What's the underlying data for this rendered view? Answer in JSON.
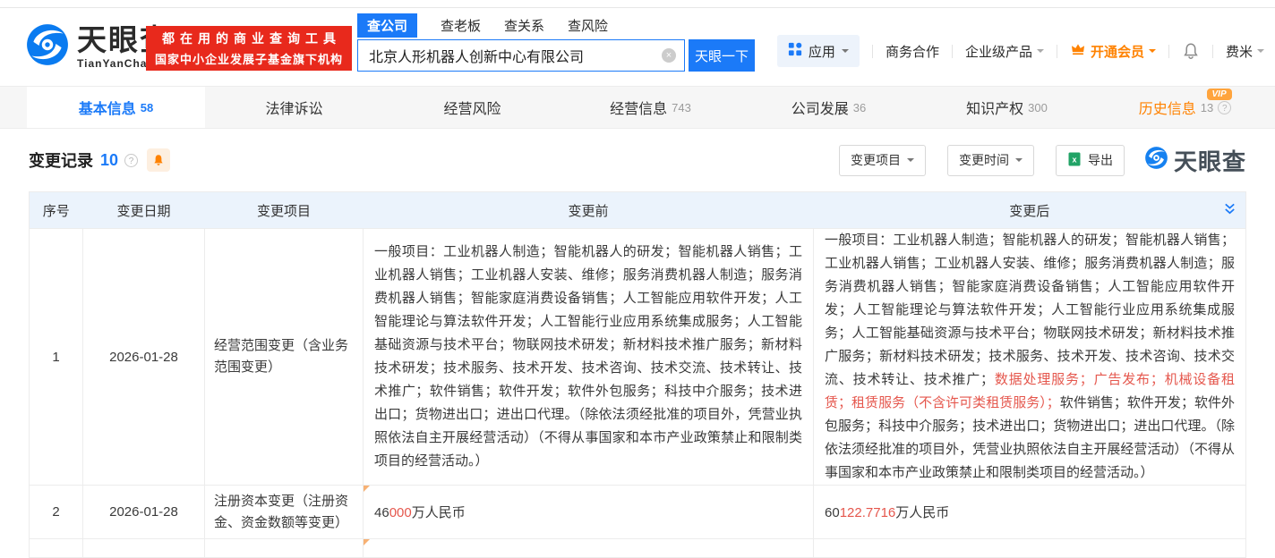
{
  "header": {
    "logo": {
      "name": "天眼查",
      "domain": "TianYanCha.com"
    },
    "promo": {
      "line1": "都在用的商业查询工具",
      "line2": "国家中小企业发展子基金旗下机构"
    },
    "search": {
      "tabs": [
        {
          "label": "查公司"
        },
        {
          "label": "查老板"
        },
        {
          "label": "查关系"
        },
        {
          "label": "查风险"
        }
      ],
      "value": "北京人形机器人创新中心有限公司",
      "button_label": "天眼一下"
    },
    "nav": {
      "apps": "应用",
      "cooperation": "商务合作",
      "enterprise": "企业级产品",
      "vip": "开通会员",
      "user": "费米"
    }
  },
  "tabs": [
    {
      "label": "基本信息",
      "count": "58"
    },
    {
      "label": "法律诉讼",
      "count": ""
    },
    {
      "label": "经营风险",
      "count": ""
    },
    {
      "label": "经营信息",
      "count": "743"
    },
    {
      "label": "公司发展",
      "count": "36"
    },
    {
      "label": "知识产权",
      "count": "300"
    },
    {
      "label": "历史信息",
      "count": "13",
      "vip_badge": "VIP"
    }
  ],
  "section": {
    "title": "变更记录",
    "count": "10",
    "filter_project": "变更项目",
    "filter_time": "变更时间",
    "export_label": "导出",
    "watermark": "天眼查"
  },
  "table": {
    "headers": [
      "序号",
      "变更日期",
      "变更项目",
      "变更前",
      "变更后"
    ],
    "rows": [
      {
        "index": "1",
        "date": "2026-01-28",
        "item": "经营范围变更（含业务范围变更）",
        "before": [
          {
            "text": "一般项目：工业机器人制造；智能机器人的研发；智能机器人销售；工业机器人销售；工业机器人安装、维修；服务消费机器人制造；服务消费机器人销售；智能家庭消费设备销售；人工智能应用软件开发；人工智能理论与算法软件开发；人工智能行业应用系统集成服务；人工智能基础资源与技术平台；物联网技术研发；新材料技术推广服务；新材料技术研发；技术服务、技术开发、技术咨询、技术交流、技术转让、技术推广；软件销售；软件开发；软件外包服务；科技中介服务；技术进出口；货物进出口；进出口代理。（除依法须经批准的项目外，凭营业执照依法自主开展经营活动）（不得从事国家和本市产业政策禁止和限制类项目的经营活动。）",
            "highlight": false
          }
        ],
        "after": [
          {
            "text": "一般项目：工业机器人制造；智能机器人的研发；智能机器人销售；工业机器人销售；工业机器人安装、维修；服务消费机器人制造；服务消费机器人销售；智能家庭消费设备销售；人工智能应用软件开发；人工智能理论与算法软件开发；人工智能行业应用系统集成服务；人工智能基础资源与技术平台；物联网技术研发；新材料技术推广服务；新材料技术研发；技术服务、技术开发、技术咨询、技术交流、技术转让、技术推广；",
            "highlight": false
          },
          {
            "text": "数据处理服务；广告发布；机械设备租赁；租赁服务（不含许可类租赁服务）；",
            "highlight": true
          },
          {
            "text": "软件销售；软件开发；软件外包服务；科技中介服务；技术进出口；货物进出口；进出口代理。（除依法须经批准的项目外，凭营业执照依法自主开展经营活动）（不得从事国家和本市产业政策禁止和限制类项目的经营活动。）",
            "highlight": false
          }
        ]
      },
      {
        "index": "2",
        "date": "2026-01-28",
        "item": "注册资本变更（注册资金、资金数额等变更）",
        "before": [
          {
            "text": "46",
            "highlight": false
          },
          {
            "text": "000",
            "highlight": true
          },
          {
            "text": "万人民币",
            "highlight": false
          }
        ],
        "after": [
          {
            "text": "60",
            "highlight": false
          },
          {
            "text": "122.7716",
            "highlight": true
          },
          {
            "text": "万人民币",
            "highlight": false
          }
        ]
      }
    ]
  },
  "icons": {
    "question": "?",
    "clear": "×"
  },
  "colors": {
    "accent_blue": "#1b7af8",
    "brand_red": "#e8291c",
    "vip_orange": "#ff8200",
    "highlight_red": "#e5574d",
    "table_header_bg": "#ebf3fc"
  }
}
